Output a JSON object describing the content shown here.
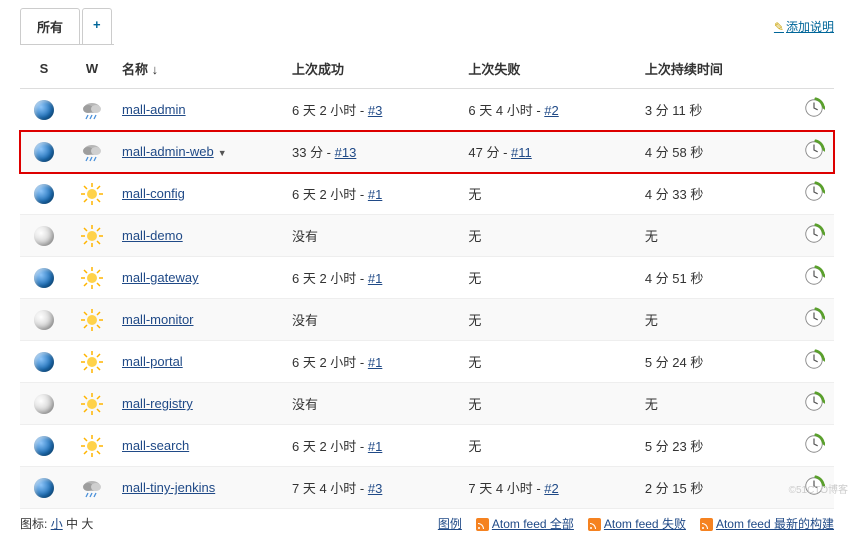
{
  "header": {
    "add_description": "添加说明",
    "tab_all": "所有",
    "tab_add": "+"
  },
  "columns": {
    "s": "S",
    "w": "W",
    "name": "名称 ↓",
    "last_success": "上次成功",
    "last_failure": "上次失败",
    "last_duration": "上次持续时间"
  },
  "jobs": [
    {
      "status": "blue",
      "weather": "rain",
      "name": "mall-admin",
      "ls_time": "6 天 2 小时",
      "ls_build": "#3",
      "lf_time": "6 天 4 小时",
      "lf_build": "#2",
      "duration": "3 分 11 秒",
      "highlight": false,
      "dropdown": false
    },
    {
      "status": "blue",
      "weather": "rain",
      "name": "mall-admin-web",
      "ls_time": "33 分",
      "ls_build": "#13",
      "lf_time": "47 分",
      "lf_build": "#11",
      "duration": "4 分 58 秒",
      "highlight": true,
      "dropdown": true
    },
    {
      "status": "blue",
      "weather": "sun",
      "name": "mall-config",
      "ls_time": "6 天 2 小时",
      "ls_build": "#1",
      "lf_time": "无",
      "lf_build": "",
      "duration": "4 分 33 秒",
      "highlight": false,
      "dropdown": false
    },
    {
      "status": "grey",
      "weather": "sun",
      "name": "mall-demo",
      "ls_time": "没有",
      "ls_build": "",
      "lf_time": "无",
      "lf_build": "",
      "duration": "无",
      "highlight": false,
      "dropdown": false
    },
    {
      "status": "blue",
      "weather": "sun",
      "name": "mall-gateway",
      "ls_time": "6 天 2 小时",
      "ls_build": "#1",
      "lf_time": "无",
      "lf_build": "",
      "duration": "4 分 51 秒",
      "highlight": false,
      "dropdown": false
    },
    {
      "status": "grey",
      "weather": "sun",
      "name": "mall-monitor",
      "ls_time": "没有",
      "ls_build": "",
      "lf_time": "无",
      "lf_build": "",
      "duration": "无",
      "highlight": false,
      "dropdown": false
    },
    {
      "status": "blue",
      "weather": "sun",
      "name": "mall-portal",
      "ls_time": "6 天 2 小时",
      "ls_build": "#1",
      "lf_time": "无",
      "lf_build": "",
      "duration": "5 分 24 秒",
      "highlight": false,
      "dropdown": false
    },
    {
      "status": "grey",
      "weather": "sun",
      "name": "mall-registry",
      "ls_time": "没有",
      "ls_build": "",
      "lf_time": "无",
      "lf_build": "",
      "duration": "无",
      "highlight": false,
      "dropdown": false
    },
    {
      "status": "blue",
      "weather": "sun",
      "name": "mall-search",
      "ls_time": "6 天 2 小时",
      "ls_build": "#1",
      "lf_time": "无",
      "lf_build": "",
      "duration": "5 分 23 秒",
      "highlight": false,
      "dropdown": false
    },
    {
      "status": "blue",
      "weather": "rain",
      "name": "mall-tiny-jenkins",
      "ls_time": "7 天 4 小时",
      "ls_build": "#3",
      "lf_time": "7 天 4 小时",
      "lf_build": "#2",
      "duration": "2 分 15 秒",
      "highlight": false,
      "dropdown": false
    }
  ],
  "footer": {
    "icon_label": "图标:",
    "small": "小",
    "medium": "中",
    "large": "大",
    "legend": "图例",
    "rss_all": "Atom feed 全部",
    "rss_fail": "Atom feed 失败",
    "rss_latest": "Atom feed 最新的构建"
  },
  "watermark": "©51CTO博客"
}
